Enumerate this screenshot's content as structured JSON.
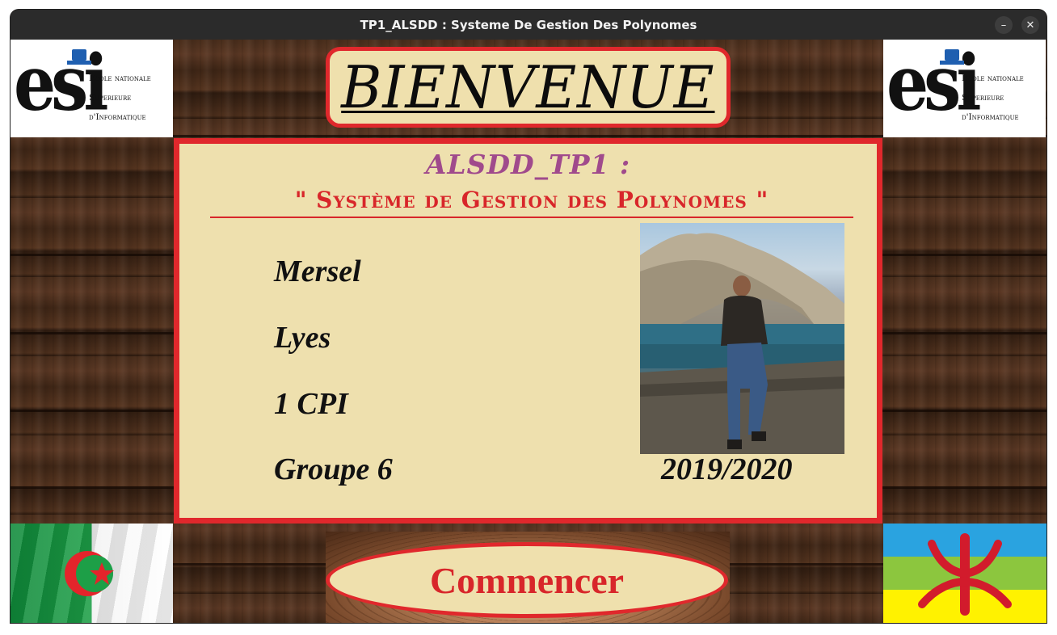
{
  "window": {
    "title": "TP1_ALSDD : Systeme De Gestion Des Polynomes",
    "minimize_icon": "minimize-icon",
    "close_icon": "close-icon"
  },
  "logos": {
    "esi_mark": "esi",
    "esi_lines": [
      "Ecole nationale",
      "Superieure",
      "d'Informatique"
    ]
  },
  "banner": {
    "text": "BIENVENUE"
  },
  "panel": {
    "subtitle": "ALSDD_TP1 :",
    "title": "\" Système de Gestion des Polynomes \"",
    "first_name": "Mersel",
    "last_name": "Lyes",
    "level": "1 CPI",
    "group": "Groupe 6",
    "year": "2019/2020"
  },
  "actions": {
    "start_label": "Commencer"
  },
  "colors": {
    "accent_red": "#e0282c",
    "panel_bg": "#eee0ae",
    "subtitle_purple": "#a04a8c",
    "titlebar": "#2b2b2b"
  },
  "flags": {
    "left": "algeria-flag",
    "right": "amazigh-flag"
  }
}
